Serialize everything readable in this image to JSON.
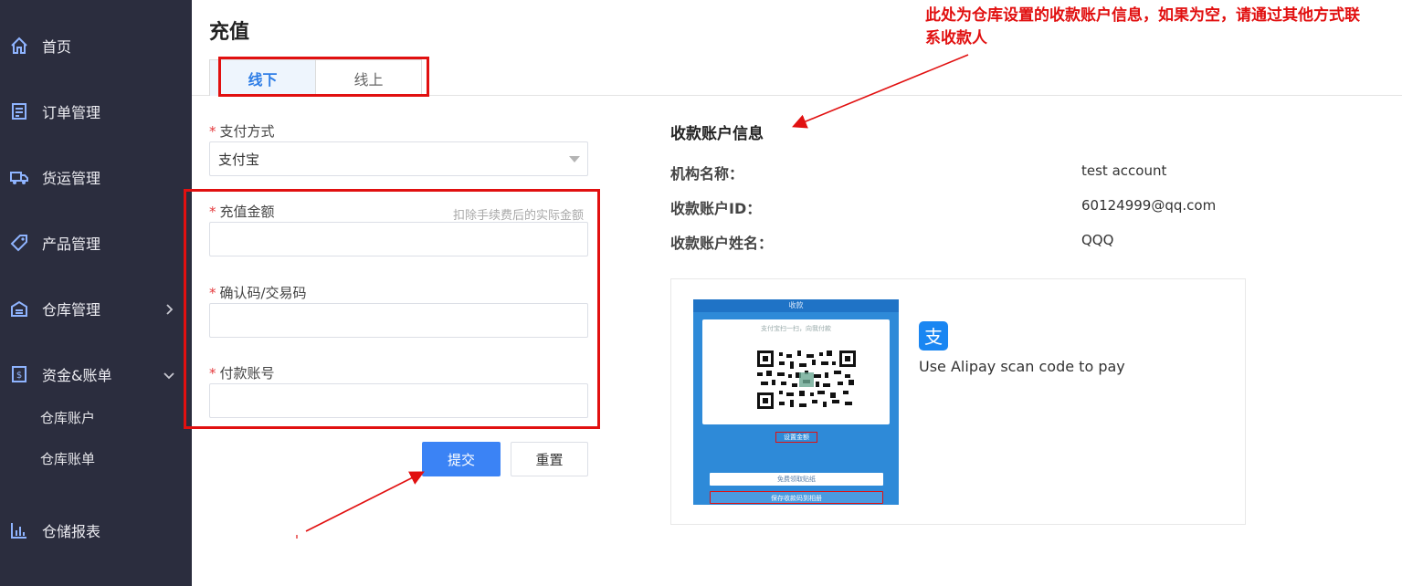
{
  "sidebar": {
    "items": [
      {
        "label": "首页",
        "icon": "home-icon"
      },
      {
        "label": "订单管理",
        "icon": "order-icon"
      },
      {
        "label": "货运管理",
        "icon": "truck-icon"
      },
      {
        "label": "产品管理",
        "icon": "tag-icon"
      },
      {
        "label": "仓库管理",
        "icon": "warehouse-icon"
      },
      {
        "label": "资金&账单",
        "icon": "ledger-icon"
      },
      {
        "label": "仓储报表",
        "icon": "bar-chart-icon"
      }
    ],
    "sub_items": [
      "仓库账户",
      "仓库账单"
    ]
  },
  "page": {
    "title": "充值"
  },
  "tabs": [
    {
      "label": "线下"
    },
    {
      "label": "线上"
    }
  ],
  "form": {
    "required_mark": "*",
    "payment_method": {
      "label": "支付方式",
      "value": "支付宝"
    },
    "amount": {
      "label": "充值金额",
      "hint": "扣除手续费后的实际金额",
      "value": ""
    },
    "confirm_code": {
      "label": "确认码/交易码",
      "value": ""
    },
    "payer_account": {
      "label": "付款账号",
      "value": ""
    },
    "submit_label": "提交",
    "reset_label": "重置"
  },
  "account_info": {
    "title": "收款账户信息",
    "rows": [
      {
        "label": "机构名称：",
        "value": "test account"
      },
      {
        "label": "收款账户ID：",
        "value": "60124999@qq.com"
      },
      {
        "label": "收款账户姓名：",
        "value": "QQQ"
      }
    ]
  },
  "qr": {
    "alipay_text": "Use Alipay scan code to pay",
    "icon_glyph": "支",
    "phone_title": "收款",
    "phone_caption": "支付宝扫一扫，向我付款",
    "phone_link": "设置金额",
    "phone_btn1": "免费领取贴纸",
    "phone_btn2": "保存收款码到相册"
  },
  "annotation": {
    "text": "此处为仓库设置的收款账户信息，如果为空，请通过其他方式联系收款人",
    "color": "#e11010"
  },
  "colors": {
    "sidebar": "#2b2d3e",
    "primary": "#3b83f5",
    "highlight": "#e11010"
  }
}
